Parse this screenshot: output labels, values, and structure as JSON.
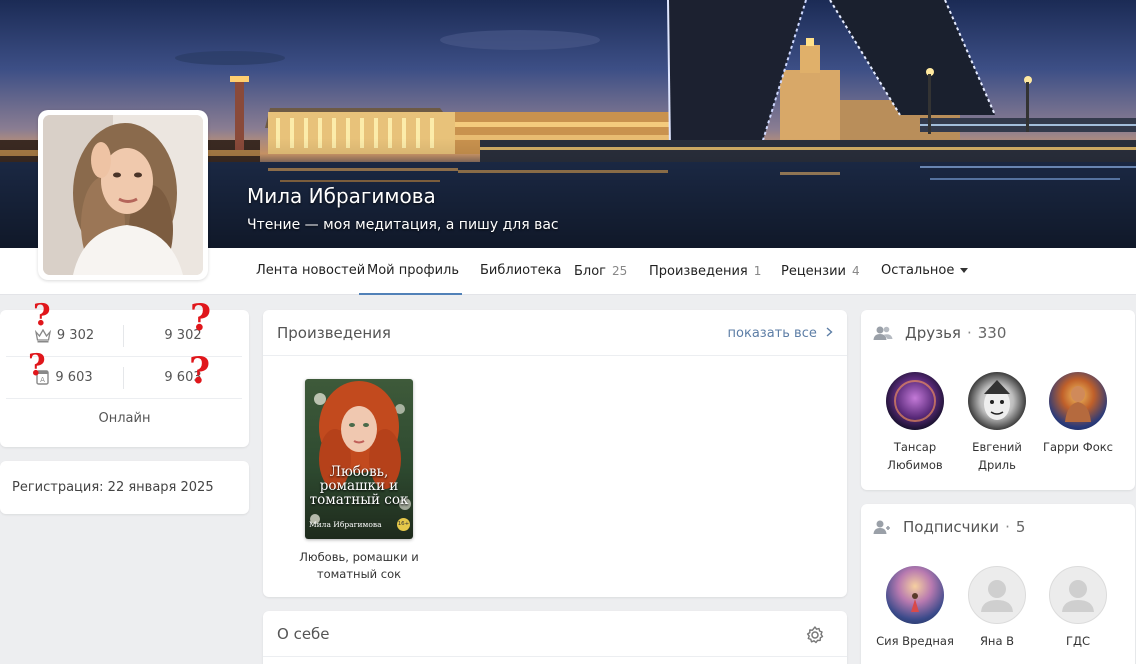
{
  "profile": {
    "name": "Мила Ибрагимова",
    "status": "Чтение — моя медитация, а пишу для вас"
  },
  "nav": {
    "tabs": [
      {
        "label": "Лента новостей",
        "count": ""
      },
      {
        "label": "Мой профиль",
        "count": ""
      },
      {
        "label": "Библиотека",
        "count": ""
      },
      {
        "label": "Блог",
        "count": "25"
      },
      {
        "label": "Произведения",
        "count": "1"
      },
      {
        "label": "Рецензии",
        "count": "4"
      },
      {
        "label": "Остальное",
        "count": ""
      }
    ],
    "active_tab": "Мой профиль"
  },
  "stats": {
    "rating_left": "9 302",
    "rating_right": "9 302",
    "views_left": "9 603",
    "views_right": "9 603",
    "online_label": "Онлайн"
  },
  "registration": "Регистрация: 22 января 2025",
  "works": {
    "title": "Произведения",
    "show_all": "показать все",
    "book_cover_title": "Любовь, ромашки и томатный сок",
    "book_cover_author": "Мила Ибрагимова",
    "book_age": "16+",
    "book_caption_line1": "Любовь, ромашки и",
    "book_caption_line2": "томатный сок"
  },
  "about": {
    "title": "О себе"
  },
  "friends": {
    "title": "Друзья",
    "count": "330",
    "people": [
      {
        "name_line1": "Тансар",
        "name_line2": "Любимов"
      },
      {
        "name_line1": "Евгений",
        "name_line2": "Дриль"
      },
      {
        "name_line1": "Гарри Фокс",
        "name_line2": ""
      }
    ]
  },
  "subscribers": {
    "title": "Подписчики",
    "count": "5",
    "people": [
      {
        "name_line1": "Сия Вредная"
      },
      {
        "name_line1": "Яна В"
      },
      {
        "name_line1": "ГДС"
      }
    ]
  },
  "colors": {
    "accent": "#5181b8",
    "link": "#5d7ea6",
    "page_bg": "#edeef0",
    "annotation_red": "#e0161b"
  },
  "icons": [
    "crown-icon",
    "book-badge-icon",
    "chevron-right-icon",
    "gear-icon",
    "friends-icon",
    "subscribers-icon",
    "caret-down-icon"
  ],
  "annotations": [
    "?",
    "?",
    "?",
    "?"
  ]
}
